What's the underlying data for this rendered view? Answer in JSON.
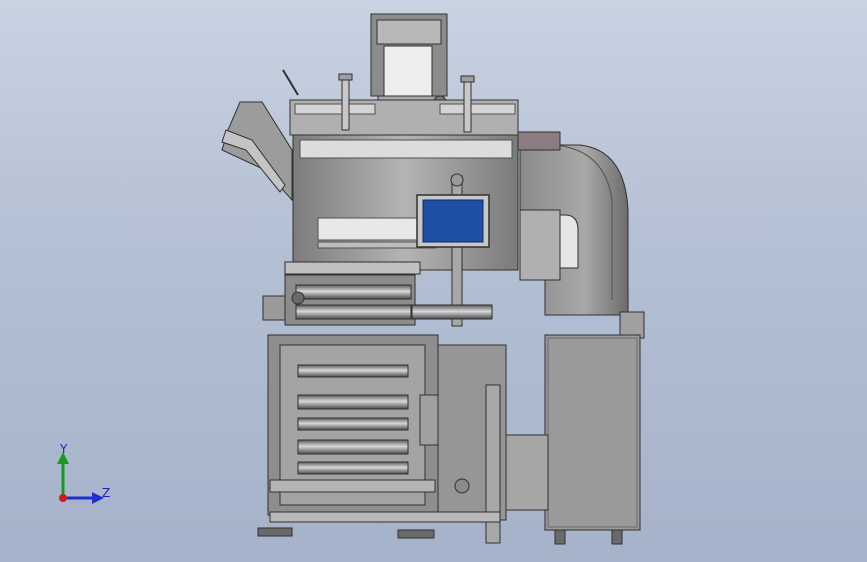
{
  "viewport": {
    "background_top": "#c9d2e1",
    "background_bottom": "#a5b2c9"
  },
  "model": {
    "description_icon": "machine-assembly-model",
    "screen_color": "#1f4fa6",
    "body_color": "#9a9a9a"
  },
  "triad": {
    "y_label": "Y",
    "z_label": "Z",
    "y_color": "#1a9a1a",
    "z_color": "#2030d0",
    "x_color": "#d01a1a"
  }
}
